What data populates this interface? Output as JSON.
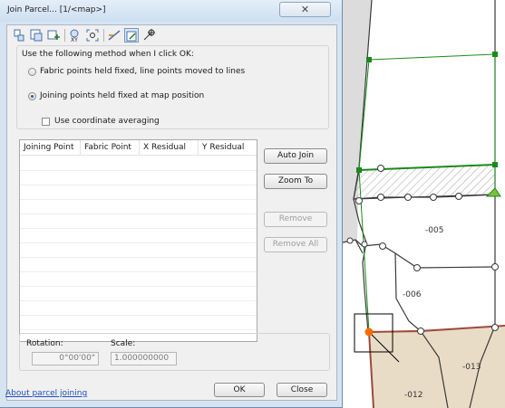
{
  "window": {
    "title": "Join Parcel... [1/<map>]",
    "close_glyph": "✕"
  },
  "toolbar": {
    "tools": [
      "join-parcel-icon",
      "select-parcel-icon",
      "add-parcel-icon",
      "xy-coordinate-icon",
      "zoom-extent-icon",
      "adjust-line-icon",
      "snap-parcel-icon",
      "move-point-icon"
    ]
  },
  "method": {
    "heading": "Use the following method when I click OK:",
    "option_fabric": "Fabric points held fixed, line points moved to lines",
    "option_joining": "Joining points held fixed at map position",
    "selected": "joining",
    "use_averaging": "Use coordinate averaging",
    "use_averaging_checked": false
  },
  "table": {
    "columns": [
      "Joining Point",
      "Fabric Point",
      "X Residual",
      "Y Residual"
    ],
    "rows": []
  },
  "buttons": {
    "auto_join": "Auto Join",
    "zoom_to": "Zoom To",
    "remove": "Remove",
    "remove_all": "Remove All",
    "ok": "OK",
    "close": "Close"
  },
  "transform": {
    "rotation_label": "Rotation:",
    "rotation_value": "0°00'00\"",
    "scale_label": "Scale:",
    "scale_value": "1.000000000"
  },
  "footer": {
    "help_link": "About parcel joining"
  },
  "map": {
    "parcel_labels": [
      "-005",
      "-006",
      "-013",
      "-012"
    ],
    "colors": {
      "selected_parcel": "#1a8a1a",
      "parcel_line": "#3a3a3a",
      "fabric_parcel_fill": "#e9dcc6",
      "fabric_parcel_outline": "#9b4a3c",
      "join_point": "#ff6a00"
    }
  }
}
